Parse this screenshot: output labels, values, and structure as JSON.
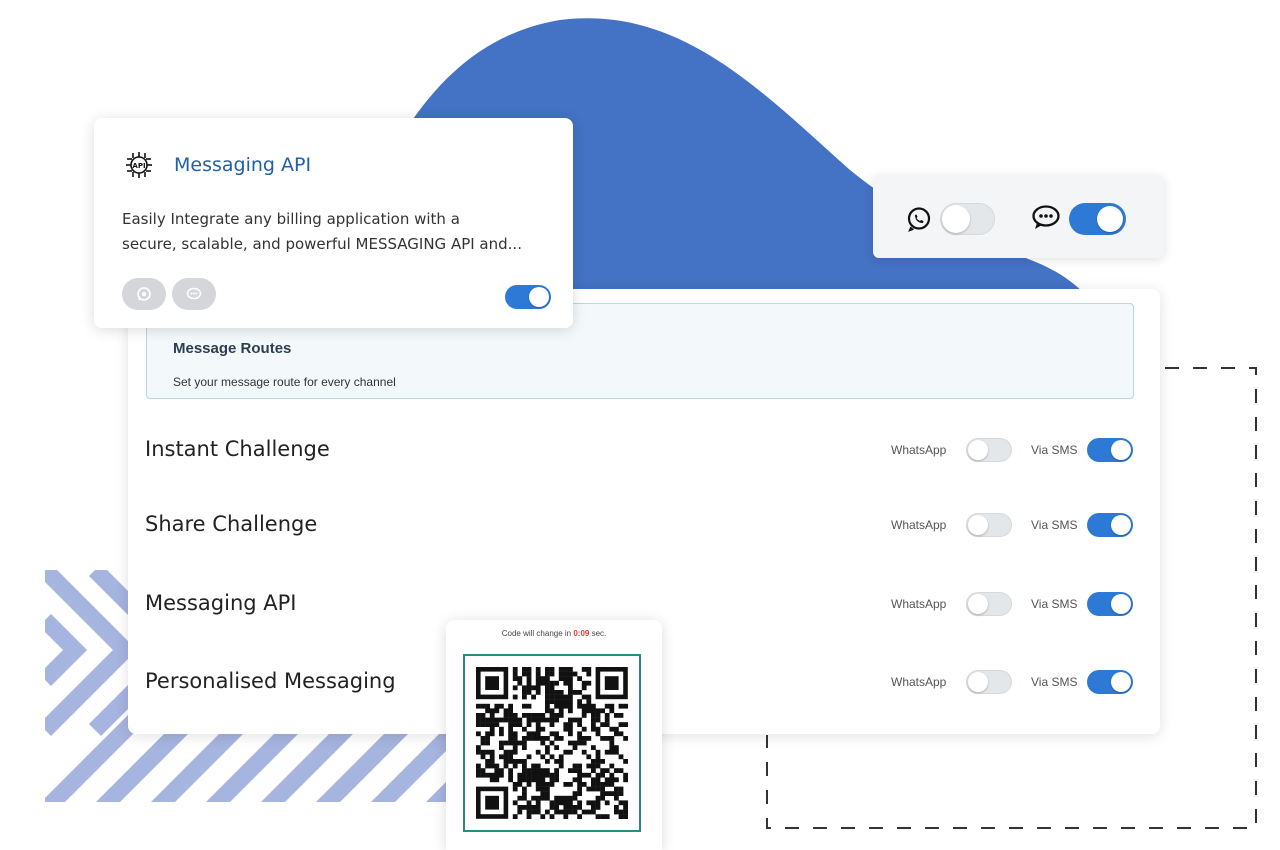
{
  "api_card": {
    "title": "Messaging API",
    "description_line1": "Easily Integrate any billing application with a",
    "description_line2": "secure, scalable, and powerful MESSAGING API and...",
    "icon": "api-chip-icon",
    "channels": [
      "whatsapp-icon",
      "sms-chat-icon"
    ],
    "enabled": true
  },
  "channel_card": {
    "whatsapp_enabled": false,
    "sms_enabled": true
  },
  "routes": {
    "title": "Message Routes",
    "subtitle": "Set your message route for every channel",
    "whatsapp_label": "WhatsApp",
    "sms_label": "Via SMS",
    "rows": [
      {
        "label": "Instant Challenge",
        "whatsapp": false,
        "sms": true
      },
      {
        "label": "Share Challenge",
        "whatsapp": false,
        "sms": true
      },
      {
        "label": "Messaging API",
        "whatsapp": false,
        "sms": true
      },
      {
        "label": "Personalised Messaging",
        "whatsapp": false,
        "sms": true
      }
    ]
  },
  "qr": {
    "caption_prefix": "Code will change in",
    "timer": "0:09",
    "caption_suffix": "sec."
  },
  "colors": {
    "accent_blue": "#2d7ad6",
    "blob_blue": "#4472c4",
    "title_blue": "#1f5fae",
    "timer_red": "#e53935",
    "qr_border": "#2a8c7e"
  }
}
